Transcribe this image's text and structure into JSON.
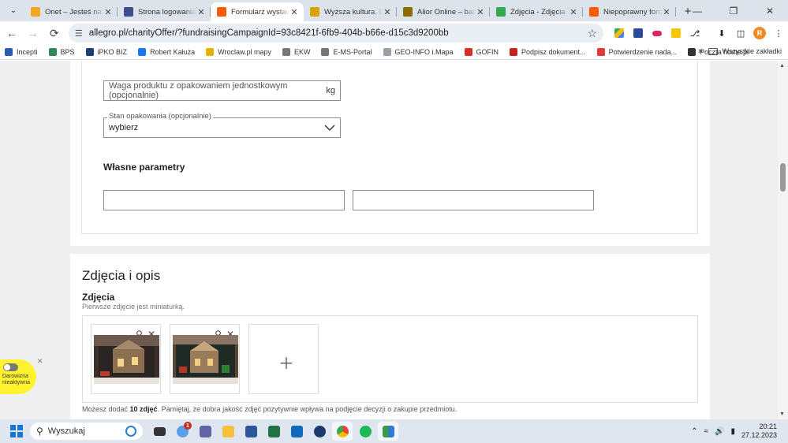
{
  "browser": {
    "tabs": [
      {
        "title": "Onet – Jesteś na bieżąco",
        "color": "#f5a623",
        "glyph": "",
        "active": false
      },
      {
        "title": "Strona logowania | iPKO",
        "color": "#3b4f8f",
        "glyph": "",
        "active": false
      },
      {
        "title": "Formularz wystawiania",
        "color": "#ff5a00",
        "glyph": "a",
        "active": true
      },
      {
        "title": "Wyższa kultura. Bank",
        "color": "#d9a400",
        "glyph": "",
        "active": false
      },
      {
        "title": "Alior Online – bankowość",
        "color": "#8a6d00",
        "glyph": "",
        "active": false
      },
      {
        "title": "Zdjęcia - Zdjęcia Google",
        "color": "#34a853",
        "glyph": "",
        "active": false
      },
      {
        "title": "Niepoprawny formularz",
        "color": "#ff5a00",
        "glyph": "a",
        "active": false
      }
    ],
    "url": "allegro.pl/charityOffer/?fundraisingCampaignId=93c8421f-6fb9-404b-b66e-d15c3d9200bb",
    "profile_initial": "R",
    "bookmarks": [
      {
        "label": "Incepti",
        "color": "#2a5db0"
      },
      {
        "label": "BPS",
        "color": "#2e8b57"
      },
      {
        "label": "iPKO BIZ",
        "color": "#1f3d7a"
      },
      {
        "label": "Robert Kałuża",
        "color": "#1877f2"
      },
      {
        "label": "Wroclaw.pl mapy",
        "color": "#e3b100"
      },
      {
        "label": "EKW",
        "color": "#777777"
      },
      {
        "label": "E-MS-Portal",
        "color": "#777777"
      },
      {
        "label": "GEO-INFO i.Mapa",
        "color": "#9aa0a6"
      },
      {
        "label": "GOFIN",
        "color": "#d93025"
      },
      {
        "label": "Podpisz dokument...",
        "color": "#c5221f"
      },
      {
        "label": "Potwierdzenie nada...",
        "color": "#e53935"
      },
      {
        "label": "Poczta home.pl",
        "color": "#333333"
      }
    ],
    "bookmarks_more": "»",
    "all_bookmarks": "Wszystkie zakładki"
  },
  "form": {
    "weight_placeholder": "Waga produktu z opakowaniem jednostkowym (opcjonalnie)",
    "weight_unit": "kg",
    "packaging_legend": "Stan opakowania (opcjonalnie)",
    "packaging_value": "wybierz",
    "own_params_title": "Własne parametry"
  },
  "photos": {
    "section_title": "Zdjęcia i opis",
    "title": "Zdjęcia",
    "subtitle": "Pierwsze zdjęcie jest miniaturką.",
    "note_prefix": "Możesz dodać",
    "note_bold": "10 zdjęć",
    "note_suffix": ". Pamiętaj, że dobra jakość zdjęć pozytywnie wpływa na podjęcie decyzji o zakupie przedmiotu."
  },
  "widget": {
    "label_line1": "Darowizna",
    "label_line2": "nieaktywna"
  },
  "taskbar": {
    "search_label": "Wyszukaj",
    "notification_count": "1",
    "time": "20:21",
    "date": "27.12.2023"
  }
}
